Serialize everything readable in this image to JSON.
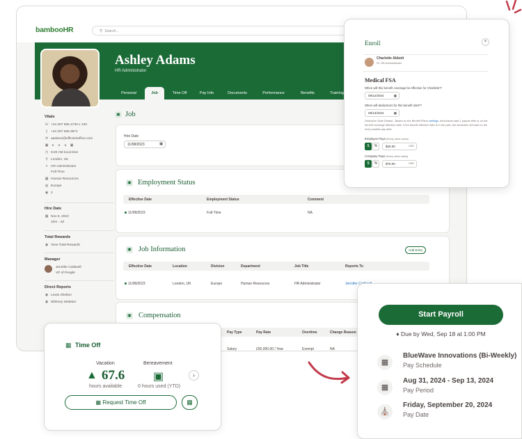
{
  "app": {
    "logo": "bambooHR",
    "search_placeholder": "Search..."
  },
  "employee": {
    "name": "Ashley Adams",
    "title": "HR Administrator"
  },
  "tabs": [
    "Personal",
    "Job",
    "Time Off",
    "Pay Info",
    "Documents",
    "Performance",
    "Benefits",
    "Training"
  ],
  "sidebar": {
    "vitals_heading": "Vitals",
    "phone1": "+44 207 555 4730 x 130",
    "phone2": "+44 207 555 6671",
    "email": "aadams@efficientoffice.com",
    "local_time": "9:20 AM local time",
    "location": "London, UK",
    "job_title": "HR Administrator",
    "employment_type": "Full-Time",
    "department": "Human Resources",
    "region": "Europe",
    "reports_count": "2",
    "hire_date_heading": "Hire Date",
    "hire_date": "Nov 8, 2023",
    "tenure": "10m - 4d",
    "total_rewards_heading": "Total Rewards",
    "total_rewards_link": "View Total Rewards",
    "manager_heading": "Manager",
    "manager_name": "Jennifer Caldwell",
    "manager_title": "VP of People",
    "direct_reports_heading": "Direct Reports",
    "direct_reports": [
      "Lewis Shelton",
      "Whitney Webster"
    ]
  },
  "job": {
    "heading": "Job",
    "hire_date_label": "Hire Date",
    "hire_date_value": "11/08/2023"
  },
  "employment_status": {
    "heading": "Employment Status",
    "columns": [
      "Effective Date",
      "Employment Status",
      "Comment"
    ],
    "rows": [
      [
        "11/08/2023",
        "Full-Time",
        "NA"
      ]
    ]
  },
  "job_information": {
    "heading": "Job Information",
    "add_entry": "Add Entry",
    "columns": [
      "Effective Date",
      "Location",
      "Division",
      "Department",
      "Job Title",
      "Reports To"
    ],
    "rows": [
      [
        "11/08/2023",
        "London, UK",
        "Europe",
        "Human Resources",
        "HR Administrator",
        "Jennifer Caldwell"
      ]
    ]
  },
  "compensation": {
    "heading": "Compensation",
    "columns": [
      "Pay Type",
      "Pay Rate",
      "Overtime",
      "Change Reason"
    ],
    "rows": [
      [
        "Salary",
        "£50,000.00 / Year",
        "Exempt",
        "NA"
      ]
    ]
  },
  "enroll": {
    "title": "Enroll",
    "person_name": "Charlotte Abbott",
    "person_title": "Sr. HR Administrator",
    "plan": "Medical FSA",
    "q1": "When will this benefit coverage be effective for Charlotte?*",
    "q1_value": "09/12/2024",
    "q2": "When will deductions for this benefit start?*",
    "q2_value": "09/13/2024",
    "note_a": "Deduction Date Default - Based on the Benefit Plan's ",
    "note_link": "settings",
    "note_b": ", deductions start 1 payroll after or on the benefit coverage effective date. If the benefit effective date is in the past, the deduction will start on the next possible pay date.",
    "employee_pays_label": "Employee Pays",
    "employee_pays_freq": "(Every other week)",
    "employee_pays_value": "$25.00",
    "company_pays_label": "Company Pays",
    "company_pays_freq": "(Every other week)",
    "company_pays_value": "$75.00",
    "currency": "USD",
    "dollar": "$",
    "percent": "%"
  },
  "time_off": {
    "heading": "Time Off",
    "vacation_label": "Vacation",
    "vacation_value": "67.6",
    "vacation_sub": "hours available",
    "bereavement_label": "Bereavement",
    "bereavement_value": "0",
    "bereavement_sub": "0 hours used (YTD)",
    "request_button": "Request Time Off"
  },
  "payroll": {
    "start_button": "Start Payroll",
    "due": "Due by Wed, Sep 18 at 1:00 PM",
    "schedule_title": "BlueWave Innovations (Bi-Weekly)",
    "schedule_label": "Pay Schedule",
    "period_title": "Aug 31, 2024 - Sep 13, 2024",
    "period_label": "Pay Period",
    "date_title": "Friday, September 20, 2024",
    "date_label": "Pay Date"
  },
  "colors": {
    "brand_green": "#1b6b37",
    "arrow_red": "#c23a4a",
    "link_blue": "#1a6fc0"
  },
  "icons": [
    "search-icon",
    "briefcase-icon",
    "calendar-icon",
    "palm-tree-icon",
    "suitcase-icon",
    "bell-icon",
    "bank-icon",
    "chevron-right-icon",
    "close-icon"
  ]
}
